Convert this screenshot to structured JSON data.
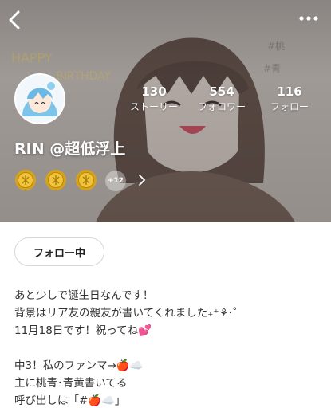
{
  "profile": {
    "username": "RIN @超低浮上",
    "avatar_icon": "anime-avatar-icon",
    "stats": [
      {
        "value": "130",
        "label": "ストーリー"
      },
      {
        "value": "554",
        "label": "フォロワー"
      },
      {
        "value": "116",
        "label": "フォロー"
      }
    ],
    "badges": {
      "visible_medals": 3,
      "more_count": "+12"
    },
    "follow_button_label": "フォロー中"
  },
  "bio": {
    "lines": [
      "あと少しで誕生日なんです！",
      "背景はリア友の親友が書いてくれました₊⁺⚘·˚",
      "11月18日です！祝ってね💕",
      "",
      "中3！私のファンマ→🍎☁️",
      "主に桃青･青黄書いてる",
      "呼び出しは「#🍎☁️」"
    ]
  },
  "colors": {
    "header_tint": "#9d9793",
    "medal_gold": "#d6a21c",
    "text": "#333333"
  },
  "icons": {
    "back": "back-chevron-icon",
    "more": "more-dots-icon",
    "badges_arrow": "chevron-right-icon"
  }
}
